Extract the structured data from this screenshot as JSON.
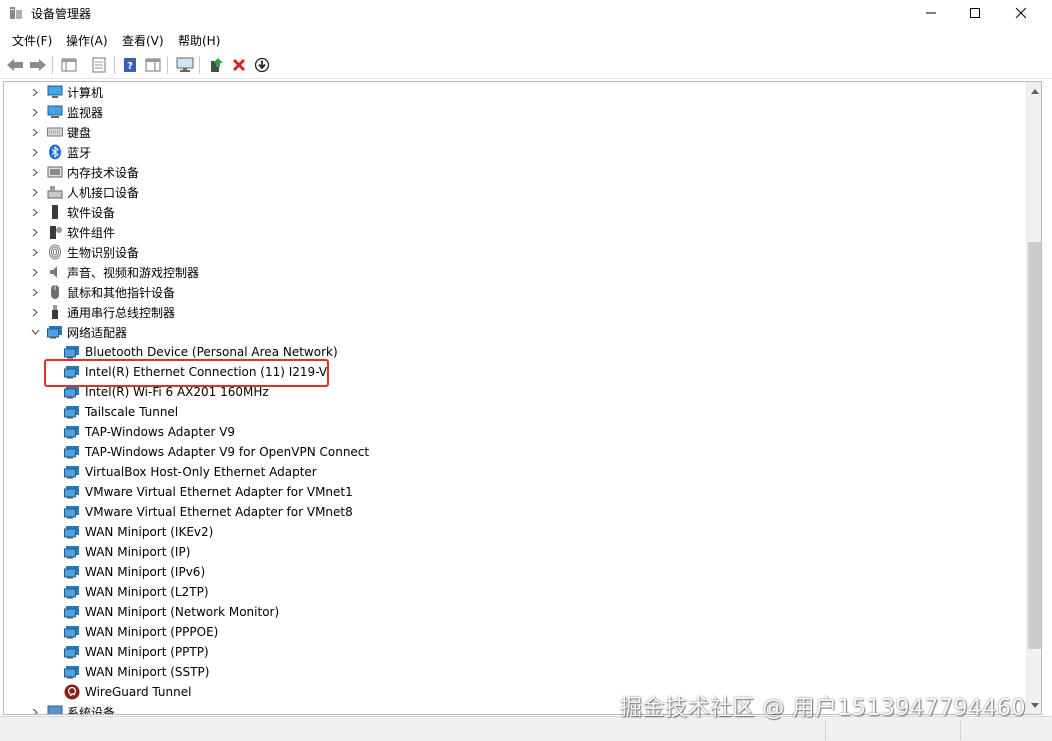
{
  "window": {
    "title": "设备管理器",
    "controls": {
      "minimize": "—",
      "maximize": "☐",
      "close": "✕"
    }
  },
  "menu": [
    "文件(F)",
    "操作(A)",
    "查看(V)",
    "帮助(H)"
  ],
  "toolbar": {
    "icons": [
      "back-arrow-icon",
      "forward-arrow-icon",
      "show-hide-tree-icon",
      "properties-icon",
      "help-icon",
      "action-pane-icon",
      "monitor-icon",
      "update-driver-icon",
      "uninstall-icon",
      "scan-hardware-icon"
    ]
  },
  "tree": {
    "categories": [
      {
        "label": "计算机",
        "expanded": false,
        "icon": "computer-icon"
      },
      {
        "label": "监视器",
        "expanded": false,
        "icon": "monitor-icon"
      },
      {
        "label": "键盘",
        "expanded": false,
        "icon": "keyboard-icon"
      },
      {
        "label": "蓝牙",
        "expanded": false,
        "icon": "bluetooth-icon"
      },
      {
        "label": "内存技术设备",
        "expanded": false,
        "icon": "memory-device-icon"
      },
      {
        "label": "人机接口设备",
        "expanded": false,
        "icon": "hid-icon"
      },
      {
        "label": "软件设备",
        "expanded": false,
        "icon": "software-device-icon"
      },
      {
        "label": "软件组件",
        "expanded": false,
        "icon": "software-component-icon"
      },
      {
        "label": "生物识别设备",
        "expanded": false,
        "icon": "fingerprint-icon"
      },
      {
        "label": "声音、视频和游戏控制器",
        "expanded": false,
        "icon": "speaker-icon"
      },
      {
        "label": "鼠标和其他指针设备",
        "expanded": false,
        "icon": "mouse-icon"
      },
      {
        "label": "通用串行总线控制器",
        "expanded": false,
        "icon": "usb-icon"
      },
      {
        "label": "网络适配器",
        "expanded": true,
        "icon": "network-adapter-icon"
      }
    ],
    "network_adapters": [
      "Bluetooth Device (Personal Area Network)",
      "Intel(R) Ethernet Connection (11) I219-V",
      "Intel(R) Wi-Fi 6 AX201 160MHz",
      "Tailscale Tunnel",
      "TAP-Windows Adapter V9",
      "TAP-Windows Adapter V9 for OpenVPN Connect",
      "VirtualBox Host-Only Ethernet Adapter",
      "VMware Virtual Ethernet Adapter for VMnet1",
      "VMware Virtual Ethernet Adapter for VMnet8",
      "WAN Miniport (IKEv2)",
      "WAN Miniport (IP)",
      "WAN Miniport (IPv6)",
      "WAN Miniport (L2TP)",
      "WAN Miniport (Network Monitor)",
      "WAN Miniport (PPPOE)",
      "WAN Miniport (PPTP)",
      "WAN Miniport (SSTP)",
      "WireGuard Tunnel"
    ],
    "highlighted_adapter": "Intel(R) Ethernet Connection (11) I219-V",
    "trailing_category": {
      "label": "系统设备",
      "expanded": false,
      "icon": "system-device-icon"
    }
  },
  "watermark": "掘金技术社区 @ 用户1513947794460",
  "colors": {
    "highlight": "#e0302a",
    "adapter_icon": "#2a7ab8",
    "wireguard_icon": "#8b1a1a"
  }
}
